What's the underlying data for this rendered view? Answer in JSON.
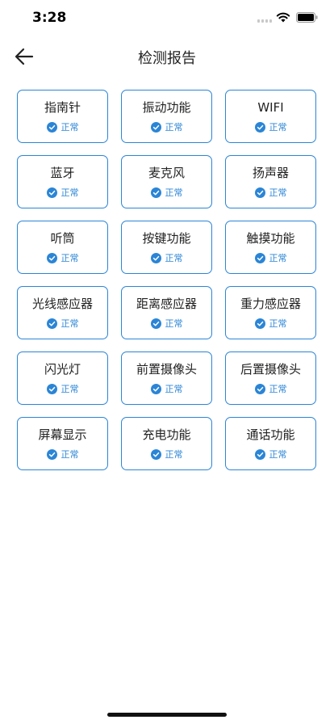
{
  "status_bar": {
    "time": "3:28"
  },
  "header": {
    "title": "检测报告"
  },
  "colors": {
    "accent": "#2b85d6",
    "title_text": "#222222"
  },
  "items": [
    {
      "name": "指南针",
      "status": "正常"
    },
    {
      "name": "振动功能",
      "status": "正常"
    },
    {
      "name": "WIFI",
      "status": "正常"
    },
    {
      "name": "蓝牙",
      "status": "正常"
    },
    {
      "name": "麦克风",
      "status": "正常"
    },
    {
      "name": "扬声器",
      "status": "正常"
    },
    {
      "name": "听筒",
      "status": "正常"
    },
    {
      "name": "按键功能",
      "status": "正常"
    },
    {
      "name": "触摸功能",
      "status": "正常"
    },
    {
      "name": "光线感应器",
      "status": "正常"
    },
    {
      "name": "距离感应器",
      "status": "正常"
    },
    {
      "name": "重力感应器",
      "status": "正常"
    },
    {
      "name": "闪光灯",
      "status": "正常"
    },
    {
      "name": "前置摄像头",
      "status": "正常"
    },
    {
      "name": "后置摄像头",
      "status": "正常"
    },
    {
      "name": "屏幕显示",
      "status": "正常"
    },
    {
      "name": "充电功能",
      "status": "正常"
    },
    {
      "name": "通话功能",
      "status": "正常"
    }
  ]
}
